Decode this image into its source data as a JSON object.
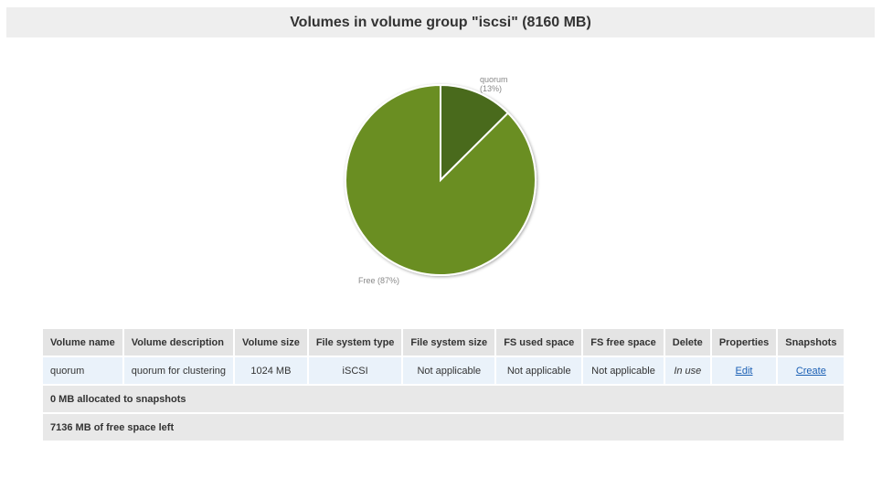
{
  "page": {
    "title": "Volumes in volume group \"iscsi\" (8160 MB)"
  },
  "chart_data": {
    "type": "pie",
    "slices": [
      {
        "label": "quorum",
        "percent_label": "(13%)",
        "value": 1024,
        "color": "#4a6b1b"
      },
      {
        "label": "Free (87%)",
        "value": 7136,
        "color": "#6b8e23"
      }
    ]
  },
  "table": {
    "headers": [
      "Volume name",
      "Volume description",
      "Volume size",
      "File system type",
      "File system size",
      "FS used space",
      "FS free space",
      "Delete",
      "Properties",
      "Snapshots"
    ],
    "rows": [
      {
        "name": "quorum",
        "description": "quorum for clustering",
        "size": "1024 MB",
        "fs_type": "iSCSI",
        "fs_size": "Not applicable",
        "fs_used": "Not applicable",
        "fs_free": "Not applicable",
        "delete": "In use",
        "properties_link": "Edit",
        "snapshots_link": "Create"
      }
    ],
    "summary": {
      "snapshots_allocated": "0 MB allocated to snapshots",
      "free_space": "7136 MB of free space left"
    }
  }
}
